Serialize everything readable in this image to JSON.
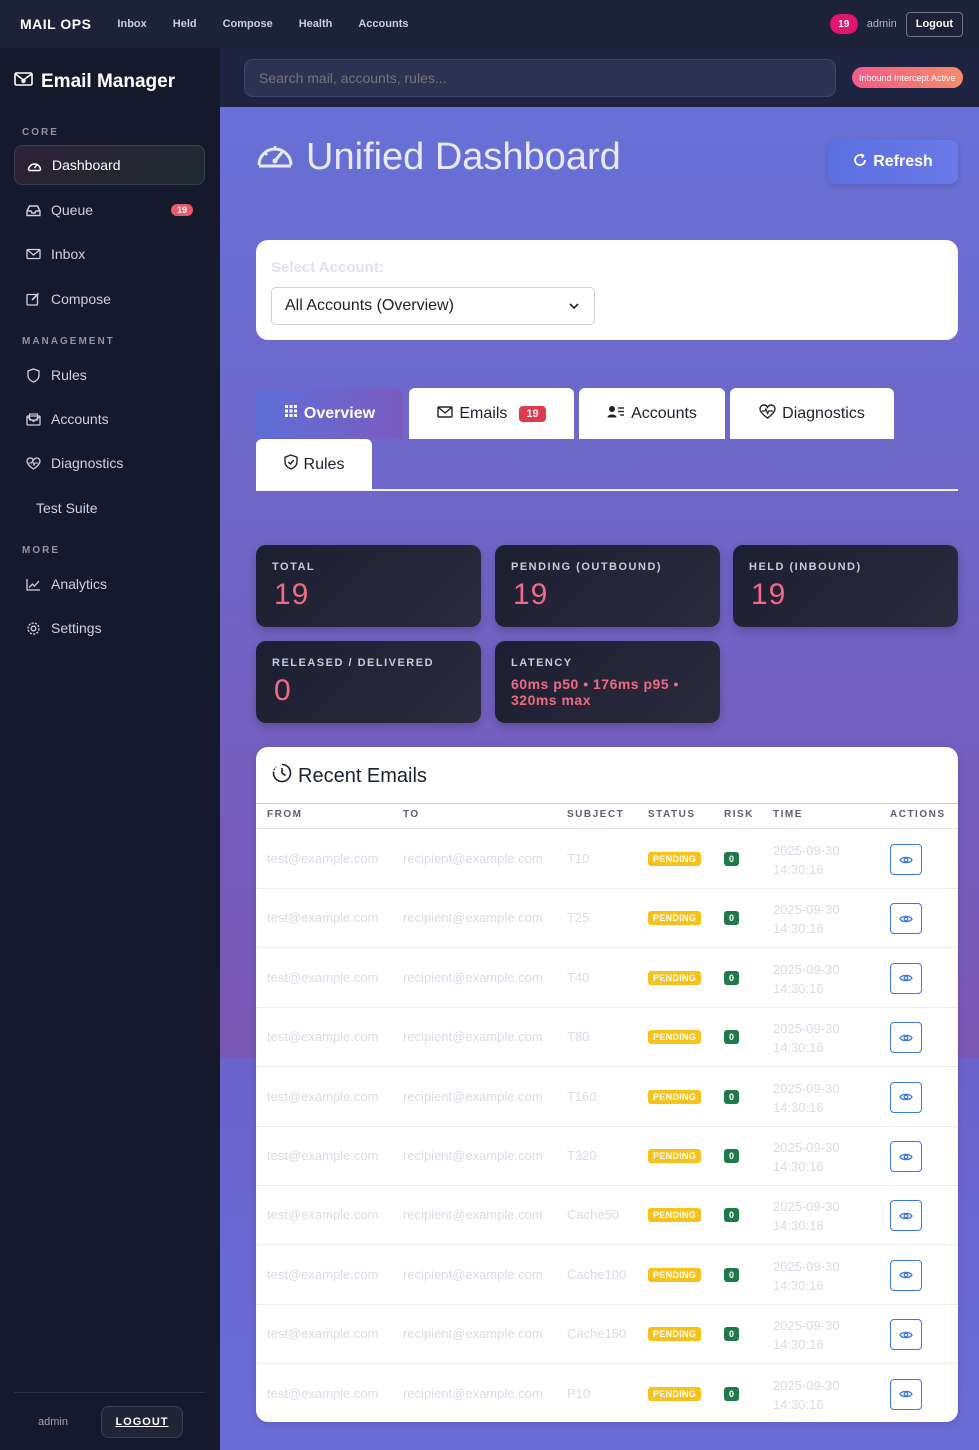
{
  "topbar": {
    "brand": "MAIL OPS",
    "nav": [
      "Inbox",
      "Held",
      "Compose",
      "Health",
      "Accounts"
    ],
    "badge_count": "19",
    "user": "admin",
    "logout": "Logout"
  },
  "sidebar": {
    "title": "Email Manager",
    "sections": {
      "core": "CORE",
      "management": "MANAGEMENT",
      "more": "MORE"
    },
    "items": [
      {
        "label": "Dashboard",
        "icon": "dashboard-icon"
      },
      {
        "label": "Queue",
        "icon": "inbox-tray-icon",
        "count": "19"
      },
      {
        "label": "Inbox",
        "icon": "envelope-icon"
      },
      {
        "label": "Compose",
        "icon": "pencil-square-icon"
      },
      {
        "label": "Rules",
        "icon": "shield-icon"
      },
      {
        "label": "Accounts",
        "icon": "envelope-paper-icon"
      },
      {
        "label": "Diagnostics",
        "icon": "heart-pulse-icon"
      },
      {
        "label": "Test Suite",
        "icon": ""
      },
      {
        "label": "Analytics",
        "icon": "graph-up-icon"
      },
      {
        "label": "Settings",
        "icon": "gear-icon"
      }
    ],
    "footer_user": "admin",
    "footer_logout": "LOGOUT"
  },
  "search": {
    "placeholder": "Search mail, accounts, rules..."
  },
  "intercept_status": "Inbound Intercept Active",
  "page": {
    "title": "Unified Dashboard",
    "refresh": "Refresh"
  },
  "account_select": {
    "label": "Select Account:",
    "value": "All Accounts (Overview)"
  },
  "tabs": [
    {
      "label": "Overview"
    },
    {
      "label": "Emails",
      "count": "19"
    },
    {
      "label": "Accounts"
    },
    {
      "label": "Diagnostics"
    },
    {
      "label": "Rules"
    }
  ],
  "stats": [
    {
      "label": "TOTAL",
      "value": "19"
    },
    {
      "label": "PENDING (OUTBOUND)",
      "value": "19"
    },
    {
      "label": "HELD (INBOUND)",
      "value": "19"
    },
    {
      "label": "RELEASED / DELIVERED",
      "value": "0"
    },
    {
      "label": "LATENCY",
      "value": "60ms p50 • 176ms p95 • 320ms max"
    }
  ],
  "recent_emails": {
    "title": "Recent Emails",
    "columns": [
      "FROM",
      "TO",
      "SUBJECT",
      "STATUS",
      "RISK",
      "TIME",
      "ACTIONS"
    ],
    "rows": [
      {
        "from": "test@example.com",
        "to": "recipient@example.com",
        "subject": "T10",
        "status": "PENDING",
        "risk": "0",
        "date": "2025-09-30",
        "time": "14:30:16"
      },
      {
        "from": "test@example.com",
        "to": "recipient@example.com",
        "subject": "T25",
        "status": "PENDING",
        "risk": "0",
        "date": "2025-09-30",
        "time": "14:30:16"
      },
      {
        "from": "test@example.com",
        "to": "recipient@example.com",
        "subject": "T40",
        "status": "PENDING",
        "risk": "0",
        "date": "2025-09-30",
        "time": "14:30:16"
      },
      {
        "from": "test@example.com",
        "to": "recipient@example.com",
        "subject": "T80",
        "status": "PENDING",
        "risk": "0",
        "date": "2025-09-30",
        "time": "14:30:16"
      },
      {
        "from": "test@example.com",
        "to": "recipient@example.com",
        "subject": "T160",
        "status": "PENDING",
        "risk": "0",
        "date": "2025-09-30",
        "time": "14:30:16"
      },
      {
        "from": "test@example.com",
        "to": "recipient@example.com",
        "subject": "T320",
        "status": "PENDING",
        "risk": "0",
        "date": "2025-09-30",
        "time": "14:30:16"
      },
      {
        "from": "test@example.com",
        "to": "recipient@example.com",
        "subject": "Cache50",
        "status": "PENDING",
        "risk": "0",
        "date": "2025-09-30",
        "time": "14:30:16"
      },
      {
        "from": "test@example.com",
        "to": "recipient@example.com",
        "subject": "Cache100",
        "status": "PENDING",
        "risk": "0",
        "date": "2025-09-30",
        "time": "14:30:16"
      },
      {
        "from": "test@example.com",
        "to": "recipient@example.com",
        "subject": "Cache150",
        "status": "PENDING",
        "risk": "0",
        "date": "2025-09-30",
        "time": "14:30:16"
      },
      {
        "from": "test@example.com",
        "to": "recipient@example.com",
        "subject": "P10",
        "status": "PENDING",
        "risk": "0",
        "date": "2025-09-30",
        "time": "14:30:16"
      }
    ]
  },
  "colors": {
    "accent": "#6672d8",
    "danger": "#e03a4f",
    "warning": "#f6c21b",
    "success": "#1f7a4a",
    "stat_value": "#f06a84"
  }
}
